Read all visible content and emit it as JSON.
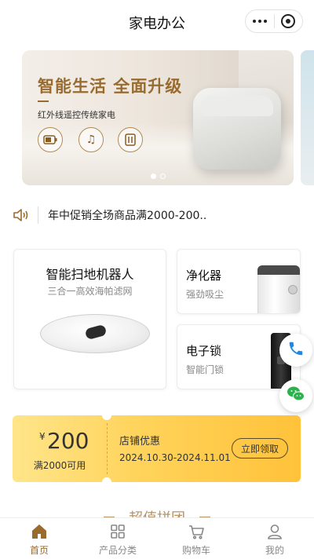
{
  "header": {
    "title": "家电办公"
  },
  "banner": {
    "headline": "智能生活 全面升级",
    "subtitle": "红外线遥控传统家电",
    "dots": 2,
    "active_dot": 1
  },
  "notice": {
    "text": "年中促销全场商品满2000-200.."
  },
  "products": {
    "robot": {
      "name": "智能扫地机器人",
      "desc": "三合一高效海帕滤网"
    },
    "purifier": {
      "name": "净化器",
      "desc": "强劲吸尘"
    },
    "lock": {
      "name": "电子锁",
      "desc": "智能门锁"
    }
  },
  "coupon": {
    "currency": "¥",
    "amount": "200",
    "condition": "满2000可用",
    "title": "店铺优惠",
    "date_range": "2024.10.30-2024.11.01",
    "claim_label": "立即领取"
  },
  "section": {
    "title": "超值拼团"
  },
  "tabbar": {
    "items": [
      {
        "label": "首页",
        "icon": "home-icon",
        "active": true
      },
      {
        "label": "产品分类",
        "icon": "grid-icon",
        "active": false
      },
      {
        "label": "购物车",
        "icon": "cart-icon",
        "active": false
      },
      {
        "label": "我的",
        "icon": "user-icon",
        "active": false
      }
    ]
  },
  "colors": {
    "accent": "#9a6b2e",
    "coupon_start": "#ffe58a",
    "coupon_end": "#ffc23a",
    "phone": "#1e88e5",
    "wechat": "#2bb24c"
  }
}
